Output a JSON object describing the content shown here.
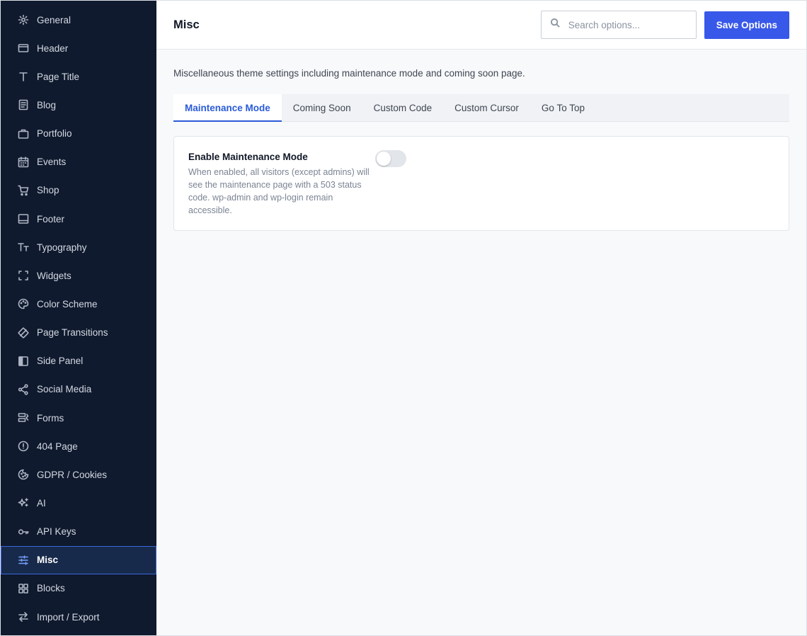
{
  "sidebar": {
    "items": [
      {
        "label": "General",
        "icon": "gear-icon"
      },
      {
        "label": "Header",
        "icon": "header-icon"
      },
      {
        "label": "Page Title",
        "icon": "title-icon"
      },
      {
        "label": "Blog",
        "icon": "blog-icon"
      },
      {
        "label": "Portfolio",
        "icon": "briefcase-icon"
      },
      {
        "label": "Events",
        "icon": "calendar-icon"
      },
      {
        "label": "Shop",
        "icon": "cart-icon"
      },
      {
        "label": "Footer",
        "icon": "footer-icon"
      },
      {
        "label": "Typography",
        "icon": "typography-icon"
      },
      {
        "label": "Widgets",
        "icon": "widgets-icon"
      },
      {
        "label": "Color Scheme",
        "icon": "palette-icon"
      },
      {
        "label": "Page Transitions",
        "icon": "transitions-icon"
      },
      {
        "label": "Side Panel",
        "icon": "side-panel-icon"
      },
      {
        "label": "Social Media",
        "icon": "share-icon"
      },
      {
        "label": "Forms",
        "icon": "forms-icon"
      },
      {
        "label": "404 Page",
        "icon": "alert-circle-icon"
      },
      {
        "label": "GDPR / Cookies",
        "icon": "cookie-icon"
      },
      {
        "label": "AI",
        "icon": "sparkles-icon"
      },
      {
        "label": "API Keys",
        "icon": "key-icon"
      },
      {
        "label": "Misc",
        "icon": "sliders-icon",
        "active": true
      },
      {
        "label": "Blocks",
        "icon": "blocks-icon"
      },
      {
        "label": "Import / Export",
        "icon": "swap-icon"
      }
    ]
  },
  "header": {
    "title": "Misc",
    "search_placeholder": "Search options...",
    "save_label": "Save Options"
  },
  "main": {
    "description": "Miscellaneous theme settings including maintenance mode and coming soon page.",
    "tabs": [
      {
        "label": "Maintenance Mode",
        "active": true
      },
      {
        "label": "Coming Soon"
      },
      {
        "label": "Custom Code"
      },
      {
        "label": "Custom Cursor"
      },
      {
        "label": "Go To Top"
      }
    ],
    "setting": {
      "label": "Enable Maintenance Mode",
      "description": "When enabled, all visitors (except admins) will see the maintenance page with a 503 status code. wp-admin and wp-login remain accessible.",
      "enabled": false
    }
  },
  "colors": {
    "sidebar_bg": "#0f1a2e",
    "accent": "#3858e9",
    "active_tab": "#2a5bd7"
  }
}
